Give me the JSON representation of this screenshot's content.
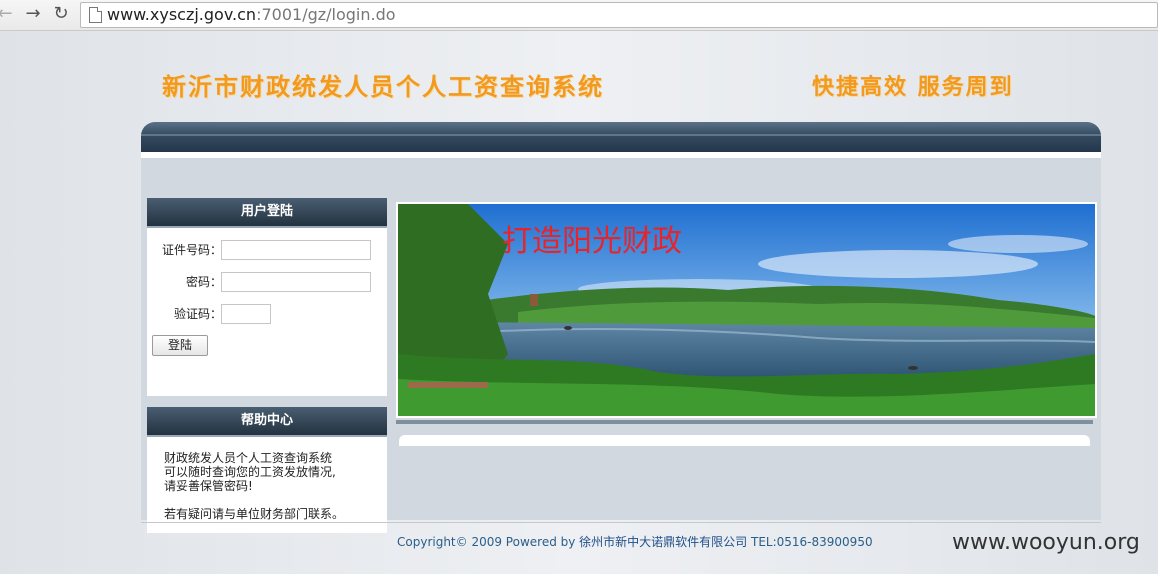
{
  "browser": {
    "url_host": "www.xysczj.gov.cn",
    "url_path": ":7001/gz/login.do"
  },
  "header": {
    "title": "新沂市财政统发人员个人工资查询系统",
    "slogan": "快捷高效  服务周到"
  },
  "login": {
    "heading": "用户登陆",
    "id_label": "证件号码：",
    "id_value": "",
    "password_label": "密码：",
    "password_value": "",
    "captcha_label": "验证码：",
    "captcha_value": "",
    "submit_label": "登陆"
  },
  "help": {
    "heading": "帮助中心",
    "lines": [
      "财政统发人员个人工资查询系统",
      "可以随时查询您的工资发放情况,",
      "请妥善保管密码!",
      "若有疑问请与单位财务部门联系。"
    ]
  },
  "banner_photo": {
    "caption": "打造阳光财政"
  },
  "footer": {
    "prefix": "Copyright© 2009 Powered by ",
    "company": "徐州市新中大诺鼎软件有限公司",
    "tel": " TEL:0516-83900950"
  },
  "watermark": "www.wooyun.org"
}
